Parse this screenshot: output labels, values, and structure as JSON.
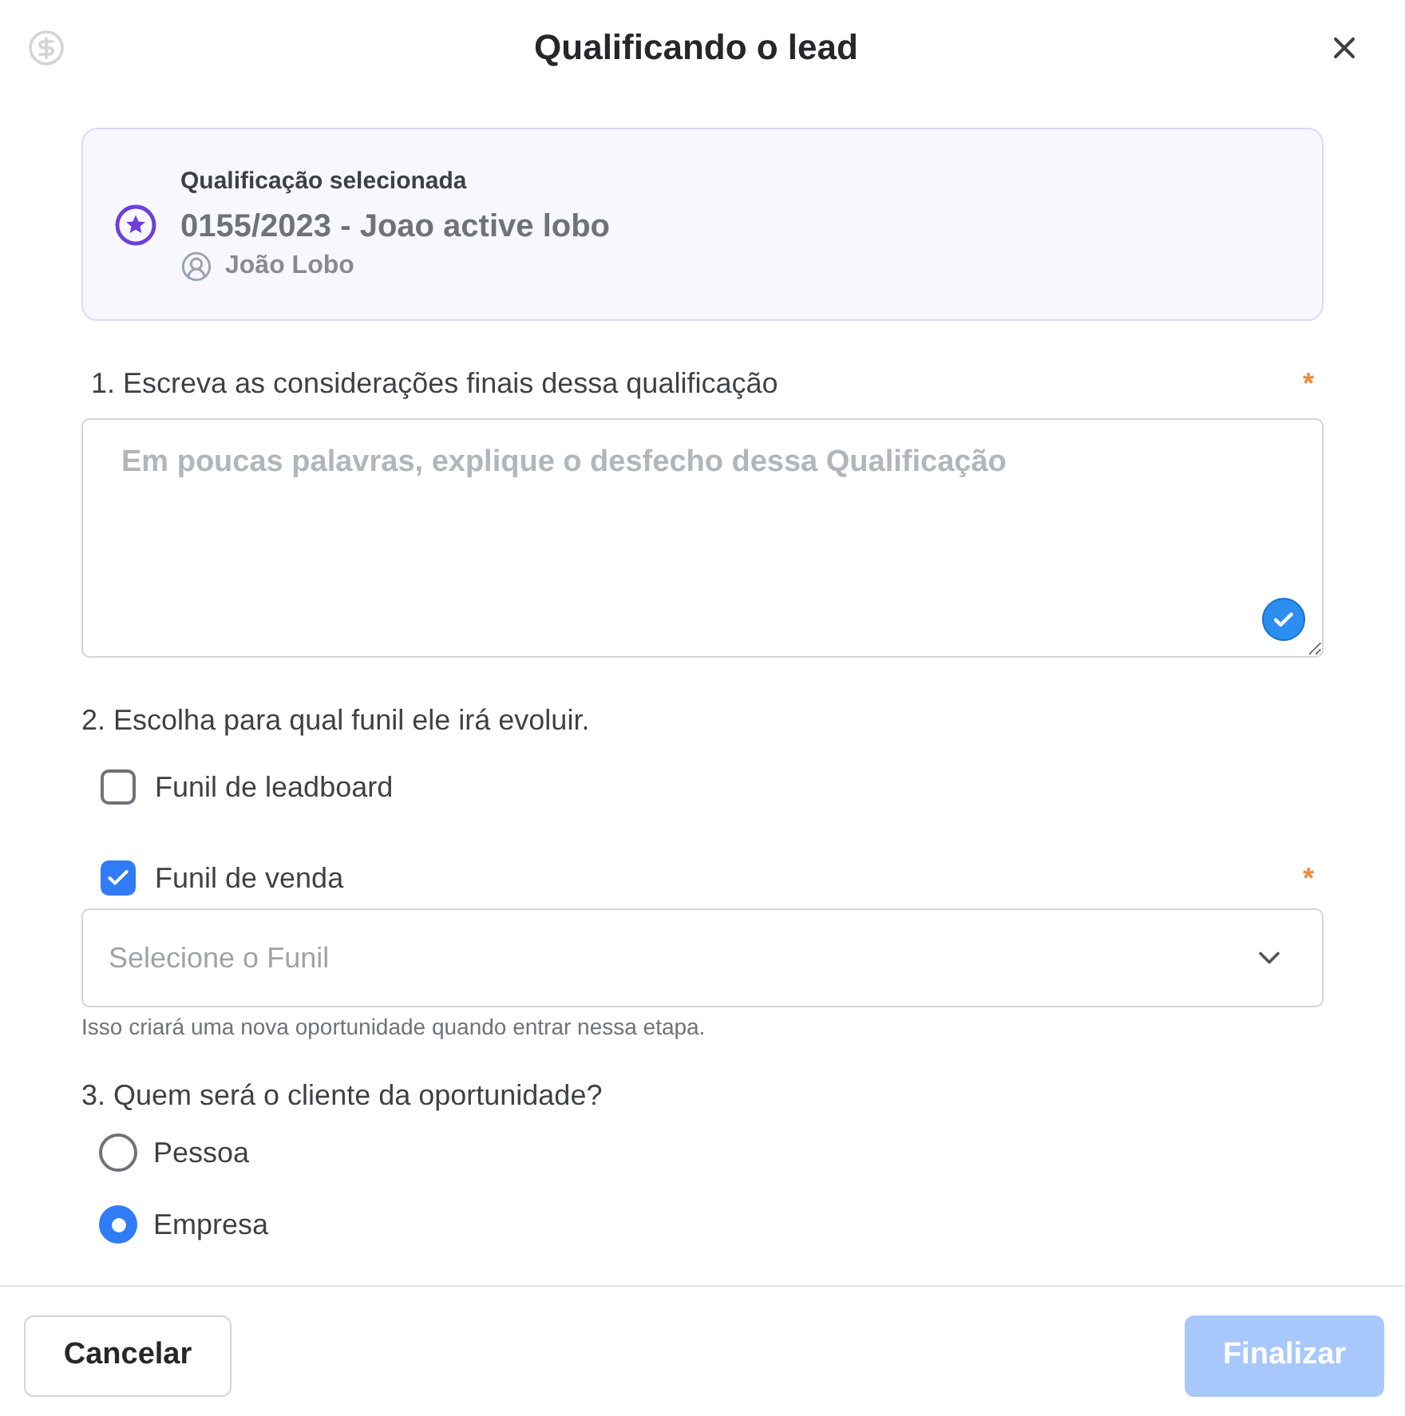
{
  "header": {
    "title": "Qualificando o lead"
  },
  "selected_qualification": {
    "label": "Qualificação selecionada",
    "name": "0155/2023 - Joao active lobo",
    "owner": "João Lobo"
  },
  "questions": [
    {
      "kind": "text",
      "label": "1. Escreva as considerações finais dessa qualificação",
      "required_mark": "*",
      "placeholder": "Em poucas palavras, explique o desfecho dessa Qualificação"
    },
    {
      "kind": "checkbox",
      "label": "2. Escolha para qual funil ele irá evoluir.",
      "options": [
        {
          "label": "Funil de leadboard",
          "checked": false
        },
        {
          "label": "Funil de venda",
          "checked": true,
          "required_mark": "*",
          "select": {
            "placeholder": "Selecione o Funil",
            "hint": "Isso criará uma nova oportunidade quando entrar nessa etapa."
          }
        }
      ]
    },
    {
      "kind": "radio",
      "label": "3. Quem será o cliente da oportunidade?",
      "options": [
        {
          "label": "Pessoa",
          "selected": false
        },
        {
          "label": "Empresa",
          "selected": true
        }
      ]
    }
  ],
  "footer": {
    "cancel": "Cancelar",
    "submit": {
      "label": "Finalizar",
      "disabled": true
    }
  }
}
